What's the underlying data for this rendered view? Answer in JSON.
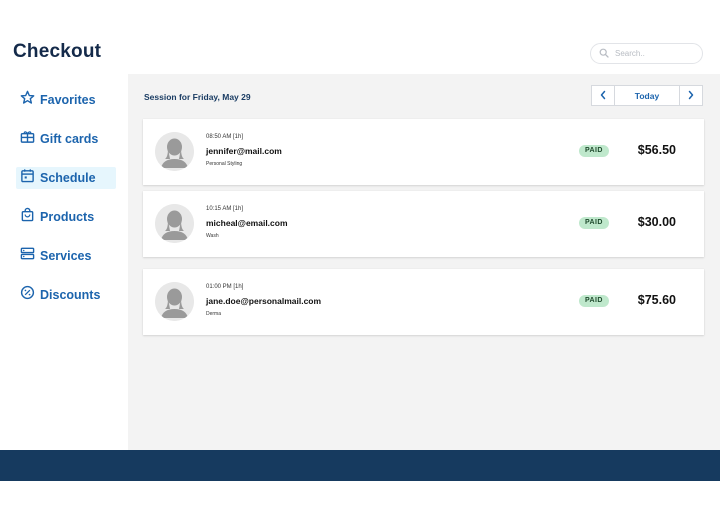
{
  "header": {
    "title": "Checkout",
    "search_placeholder": "Search.."
  },
  "sidebar": {
    "items": [
      {
        "label": "Favorites",
        "icon": "star-icon"
      },
      {
        "label": "Gift cards",
        "icon": "gift-card-icon"
      },
      {
        "label": "Schedule",
        "icon": "calendar-icon",
        "active": true
      },
      {
        "label": "Products",
        "icon": "shopping-bag-icon"
      },
      {
        "label": "Services",
        "icon": "server-icon"
      },
      {
        "label": "Discounts",
        "icon": "discount-badge-icon"
      }
    ]
  },
  "main": {
    "session_label": "Session for Friday, May 29",
    "pager": {
      "today_label": "Today"
    },
    "appointments": [
      {
        "time": "08:50 AM [1h]",
        "email": "jennifer@mail.com",
        "service": "Personal Styling",
        "status": "PAID",
        "amount": "$56.50"
      },
      {
        "time": "10:15 AM [1h]",
        "email": "micheal@email.com",
        "service": "Wash",
        "status": "PAID",
        "amount": "$30.00"
      },
      {
        "time": "01:00 PM [1h]",
        "email": "jane.doe@personalmail.com",
        "service": "Derma",
        "status": "PAID",
        "amount": "$75.60"
      }
    ]
  },
  "colors": {
    "brand_dark": "#142a4a",
    "accent": "#1c64ad",
    "footer": "#163a5f",
    "paid_badge": "#bfe8cc"
  }
}
